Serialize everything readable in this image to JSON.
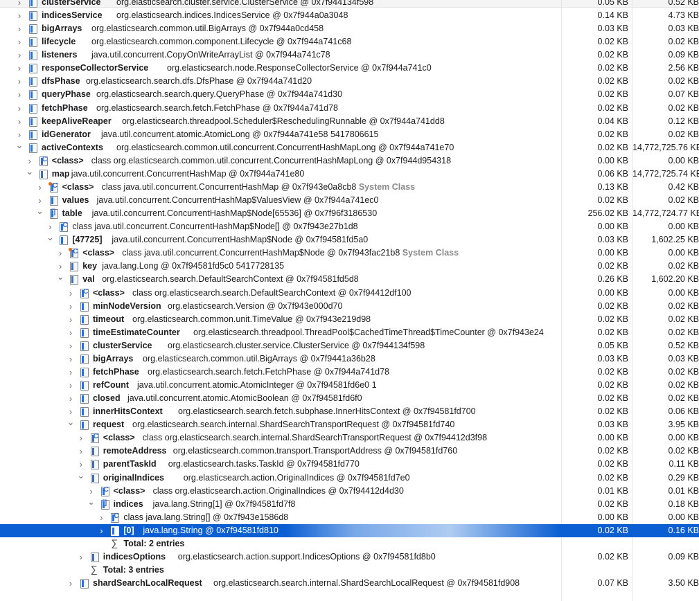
{
  "colors": {
    "selection": "#0b5fd3",
    "icon_blue": "#2f6fd6",
    "system_tag": "#8a8a8a"
  },
  "rows": [
    {
      "depth": 0,
      "tw": "right",
      "icon": "field",
      "name": "clusterService",
      "desc": "org.elasticsearch.cluster.service.ClusterService @ 0x7f944134f598",
      "s1": "0.05 KB",
      "s2": "0.52 KB"
    },
    {
      "depth": 0,
      "tw": "right",
      "icon": "field",
      "name": "indicesService",
      "desc": "org.elasticsearch.indices.IndicesService @ 0x7f944a0a3048",
      "s1": "0.14 KB",
      "s2": "4.73 KB"
    },
    {
      "depth": 0,
      "tw": "right",
      "icon": "field",
      "name": "bigArrays",
      "desc": "org.elasticsearch.common.util.BigArrays @ 0x7f944a0cd458",
      "s1": "0.03 KB",
      "s2": "0.03 KB"
    },
    {
      "depth": 0,
      "tw": "right",
      "icon": "field",
      "name": "lifecycle",
      "desc": "org.elasticsearch.common.component.Lifecycle @ 0x7f944a741c68",
      "s1": "0.02 KB",
      "s2": "0.02 KB"
    },
    {
      "depth": 0,
      "tw": "right",
      "icon": "field",
      "name": "listeners",
      "desc": "java.util.concurrent.CopyOnWriteArrayList @ 0x7f944a741c78",
      "s1": "0.02 KB",
      "s2": "0.09 KB"
    },
    {
      "depth": 0,
      "tw": "right",
      "icon": "field",
      "name": "responseCollectorService",
      "desc": "org.elasticsearch.node.ResponseCollectorService @ 0x7f944a741c0",
      "s1": "0.02 KB",
      "s2": "2.56 KB"
    },
    {
      "depth": 0,
      "tw": "right",
      "icon": "field",
      "name": "dfsPhase",
      "desc": "org.elasticsearch.search.dfs.DfsPhase @ 0x7f944a741d20",
      "s1": "0.02 KB",
      "s2": "0.02 KB"
    },
    {
      "depth": 0,
      "tw": "right",
      "icon": "field",
      "name": "queryPhase",
      "desc": "org.elasticsearch.search.query.QueryPhase @ 0x7f944a741d30",
      "s1": "0.02 KB",
      "s2": "0.07 KB"
    },
    {
      "depth": 0,
      "tw": "right",
      "icon": "field",
      "name": "fetchPhase",
      "desc": "org.elasticsearch.search.fetch.FetchPhase @ 0x7f944a741d78",
      "s1": "0.02 KB",
      "s2": "0.02 KB"
    },
    {
      "depth": 0,
      "tw": "right",
      "icon": "field",
      "name": "keepAliveReaper",
      "desc": "org.elasticsearch.threadpool.Scheduler$ReschedulingRunnable @ 0x7f944a741dd8",
      "s1": "0.04 KB",
      "s2": "0.12 KB"
    },
    {
      "depth": 0,
      "tw": "right",
      "icon": "field",
      "name": "idGenerator",
      "desc": "java.util.concurrent.atomic.AtomicLong @ 0x7f944a741e58  5417806615",
      "s1": "0.02 KB",
      "s2": "0.02 KB"
    },
    {
      "depth": 0,
      "tw": "down",
      "icon": "field",
      "name": "activeContexts",
      "desc": "org.elasticsearch.common.util.concurrent.ConcurrentHashMapLong @ 0x7f944a741e70",
      "s1": "0.02 KB",
      "s2": "14,772,725.76 KB"
    },
    {
      "depth": 1,
      "tw": "right",
      "icon": "class",
      "name": "<class>",
      "desc": "class org.elasticsearch.common.util.concurrent.ConcurrentHashMapLong @ 0x7f944d954318",
      "s1": "0.00 KB",
      "s2": "0.00 KB"
    },
    {
      "depth": 1,
      "tw": "down",
      "icon": "field",
      "name": "map",
      "desc": "java.util.concurrent.ConcurrentHashMap @ 0x7f944a741e80",
      "s1": "0.06 KB",
      "s2": "14,772,725.74 KB"
    },
    {
      "depth": 2,
      "tw": "right",
      "icon": "sysclass",
      "name": "<class>",
      "desc": "class java.util.concurrent.ConcurrentHashMap @ 0x7f943e0a8cb8",
      "tag": "System Class",
      "s1": "0.13 KB",
      "s2": "0.42 KB"
    },
    {
      "depth": 2,
      "tw": "right",
      "icon": "field",
      "name": "values",
      "desc": "java.util.concurrent.ConcurrentHashMap$ValuesView @ 0x7f944a741ec0",
      "s1": "0.02 KB",
      "s2": "0.02 KB"
    },
    {
      "depth": 2,
      "tw": "down",
      "icon": "array",
      "name": "table",
      "desc": "java.util.concurrent.ConcurrentHashMap$Node[65536] @ 0x7f96f3186530",
      "s1": "256.02 KB",
      "s2": "14,772,724.77 KB"
    },
    {
      "depth": 3,
      "tw": "right",
      "icon": "class",
      "name": "",
      "desc": "class java.util.concurrent.ConcurrentHashMap$Node[] @ 0x7f943e27b1d8",
      "s1": "0.00 KB",
      "s2": "0.00 KB"
    },
    {
      "depth": 3,
      "tw": "down",
      "icon": "field",
      "name": "[47725]",
      "desc": "java.util.concurrent.ConcurrentHashMap$Node @ 0x7f94581fd5a0",
      "s1": "0.03 KB",
      "s2": "1,602.25 KB"
    },
    {
      "depth": 4,
      "tw": "right",
      "icon": "sysclass",
      "name": "<class>",
      "desc": "class java.util.concurrent.ConcurrentHashMap$Node @ 0x7f943fac21b8",
      "tag": "System Class",
      "s1": "0.00 KB",
      "s2": "0.00 KB"
    },
    {
      "depth": 4,
      "tw": "right",
      "icon": "field",
      "name": "key",
      "desc": "java.lang.Long @ 0x7f94581fd5c0  5417728135",
      "s1": "0.02 KB",
      "s2": "0.02 KB"
    },
    {
      "depth": 4,
      "tw": "down",
      "icon": "field",
      "name": "val",
      "desc": "org.elasticsearch.search.DefaultSearchContext @ 0x7f94581fd5d8",
      "s1": "0.26 KB",
      "s2": "1,602.20 KB"
    },
    {
      "depth": 5,
      "tw": "right",
      "icon": "class",
      "name": "<class>",
      "desc": "class org.elasticsearch.search.DefaultSearchContext @ 0x7f94412df100",
      "s1": "0.00 KB",
      "s2": "0.00 KB"
    },
    {
      "depth": 5,
      "tw": "right",
      "icon": "field",
      "name": "minNodeVersion",
      "desc": "org.elasticsearch.Version @ 0x7f943e000d70",
      "s1": "0.02 KB",
      "s2": "0.02 KB"
    },
    {
      "depth": 5,
      "tw": "right",
      "icon": "field",
      "name": "timeout",
      "desc": "org.elasticsearch.common.unit.TimeValue @ 0x7f943e219d98",
      "s1": "0.02 KB",
      "s2": "0.02 KB"
    },
    {
      "depth": 5,
      "tw": "right",
      "icon": "field",
      "name": "timeEstimateCounter",
      "desc": "org.elasticsearch.threadpool.ThreadPool$CachedTimeThread$TimeCounter @ 0x7f943e24",
      "s1": "0.02 KB",
      "s2": "0.02 KB"
    },
    {
      "depth": 5,
      "tw": "right",
      "icon": "field",
      "name": "clusterService",
      "desc": "org.elasticsearch.cluster.service.ClusterService @ 0x7f944134f598",
      "s1": "0.05 KB",
      "s2": "0.52 KB"
    },
    {
      "depth": 5,
      "tw": "right",
      "icon": "field",
      "name": "bigArrays",
      "desc": "org.elasticsearch.common.util.BigArrays @ 0x7f9441a36b28",
      "s1": "0.03 KB",
      "s2": "0.03 KB"
    },
    {
      "depth": 5,
      "tw": "right",
      "icon": "field",
      "name": "fetchPhase",
      "desc": "org.elasticsearch.search.fetch.FetchPhase @ 0x7f944a741d78",
      "s1": "0.02 KB",
      "s2": "0.02 KB"
    },
    {
      "depth": 5,
      "tw": "right",
      "icon": "field",
      "name": "refCount",
      "desc": "java.util.concurrent.atomic.AtomicInteger @ 0x7f94581fd6e0  1",
      "s1": "0.02 KB",
      "s2": "0.02 KB"
    },
    {
      "depth": 5,
      "tw": "right",
      "icon": "field",
      "name": "closed",
      "desc": "java.util.concurrent.atomic.AtomicBoolean @ 0x7f94581fd6f0",
      "s1": "0.02 KB",
      "s2": "0.02 KB"
    },
    {
      "depth": 5,
      "tw": "right",
      "icon": "field",
      "name": "innerHitsContext",
      "desc": "org.elasticsearch.search.fetch.subphase.InnerHitsContext @ 0x7f94581fd700",
      "s1": "0.02 KB",
      "s2": "0.06 KB"
    },
    {
      "depth": 5,
      "tw": "down",
      "icon": "field",
      "name": "request",
      "desc": "org.elasticsearch.search.internal.ShardSearchTransportRequest @ 0x7f94581fd740",
      "s1": "0.03 KB",
      "s2": "3.95 KB"
    },
    {
      "depth": 6,
      "tw": "right",
      "icon": "class",
      "name": "<class>",
      "desc": "class org.elasticsearch.search.internal.ShardSearchTransportRequest @ 0x7f94412d3f98",
      "s1": "0.00 KB",
      "s2": "0.00 KB"
    },
    {
      "depth": 6,
      "tw": "right",
      "icon": "field",
      "name": "remoteAddress",
      "desc": "org.elasticsearch.common.transport.TransportAddress @ 0x7f94581fd760",
      "s1": "0.02 KB",
      "s2": "0.02 KB"
    },
    {
      "depth": 6,
      "tw": "right",
      "icon": "field",
      "name": "parentTaskId",
      "desc": "org.elasticsearch.tasks.TaskId @ 0x7f94581fd770",
      "s1": "0.02 KB",
      "s2": "0.11 KB"
    },
    {
      "depth": 6,
      "tw": "down",
      "icon": "field",
      "name": "originalIndices",
      "desc": "org.elasticsearch.action.OriginalIndices @ 0x7f94581fd7e0",
      "s1": "0.02 KB",
      "s2": "0.29 KB"
    },
    {
      "depth": 7,
      "tw": "right",
      "icon": "class",
      "name": "<class>",
      "desc": "class org.elasticsearch.action.OriginalIndices @ 0x7f94412d4d30",
      "s1": "0.01 KB",
      "s2": "0.01 KB"
    },
    {
      "depth": 7,
      "tw": "down",
      "icon": "array",
      "name": "indices",
      "desc": "java.lang.String[1] @ 0x7f94581fd7f8",
      "s1": "0.02 KB",
      "s2": "0.18 KB"
    },
    {
      "depth": 8,
      "tw": "right",
      "icon": "class",
      "name": "",
      "desc": "class java.lang.String[] @ 0x7f943e1586d8",
      "s1": "0.00 KB",
      "s2": "0.00 KB"
    },
    {
      "depth": 8,
      "tw": "right",
      "icon": "field",
      "name": "[0]",
      "desc": "java.lang.String @ 0x7f94581fd810",
      "s1": "0.02 KB",
      "s2": "0.16 KB",
      "selected": true
    },
    {
      "depth": 8,
      "tw": "none",
      "icon": "sum",
      "name": "Total: 2 entries",
      "desc": "",
      "s1": "",
      "s2": ""
    },
    {
      "depth": 6,
      "tw": "right",
      "icon": "field",
      "name": "indicesOptions",
      "desc": "org.elasticsearch.action.support.IndicesOptions @ 0x7f94581fd8b0",
      "s1": "0.02 KB",
      "s2": "0.09 KB"
    },
    {
      "depth": 6,
      "tw": "none",
      "icon": "sum",
      "name": "Total: 3 entries",
      "desc": "",
      "s1": "",
      "s2": ""
    },
    {
      "depth": 5,
      "tw": "right",
      "icon": "field",
      "name": "shardSearchLocalRequest",
      "desc": "org.elasticsearch.search.internal.ShardSearchLocalRequest @ 0x7f94581fd908",
      "s1": "0.07 KB",
      "s2": "3.50 KB"
    }
  ]
}
